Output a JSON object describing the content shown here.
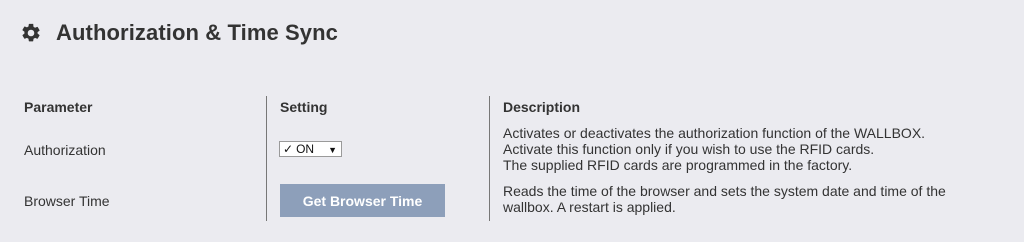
{
  "page": {
    "title": "Authorization & Time Sync"
  },
  "table": {
    "headers": {
      "parameter": "Parameter",
      "setting": "Setting",
      "description": "Description"
    },
    "rows": [
      {
        "parameter": "Authorization",
        "setting_select": {
          "check": "✓",
          "selected": "ON",
          "arrow": "▼"
        },
        "description_lines": [
          "Activates or deactivates the authorization function of the WALLBOX.",
          "Activate this function only if you wish to use the RFID cards.",
          "The supplied RFID cards are programmed in the factory."
        ]
      },
      {
        "parameter": "Browser Time",
        "setting_button": "Get Browser Time",
        "description_lines": [
          "Reads the time of the browser and sets the system date and time of the",
          "wallbox. A restart is applied."
        ]
      }
    ]
  },
  "colors": {
    "background": "#ebebf0",
    "text": "#333333",
    "button": "#8d9fba",
    "divider": "#777777"
  },
  "icons": {
    "header": "gear-icon"
  }
}
